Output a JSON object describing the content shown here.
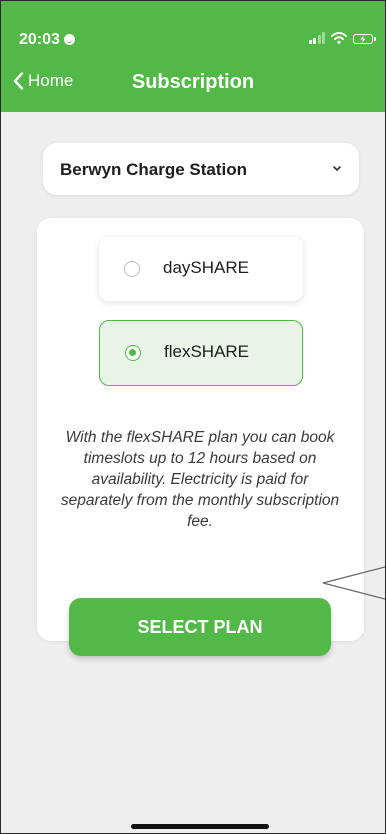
{
  "status_bar": {
    "time": "20:03"
  },
  "nav": {
    "back_label": "Home",
    "title": "Subscription"
  },
  "station_select": {
    "selected": "Berwyn Charge Station"
  },
  "plans": [
    {
      "label": "daySHARE",
      "selected": false
    },
    {
      "label": "flexSHARE",
      "selected": true
    }
  ],
  "plan_description": "With the flexSHARE plan you can book timeslots up to 12 hours based on availability. Electricity is paid for separately from the monthly subscription fee.",
  "select_button_label": "SELECT PLAN",
  "colors": {
    "accent": "#52b848",
    "selected_bg": "#e8f5e6",
    "background": "#eeeeee"
  }
}
